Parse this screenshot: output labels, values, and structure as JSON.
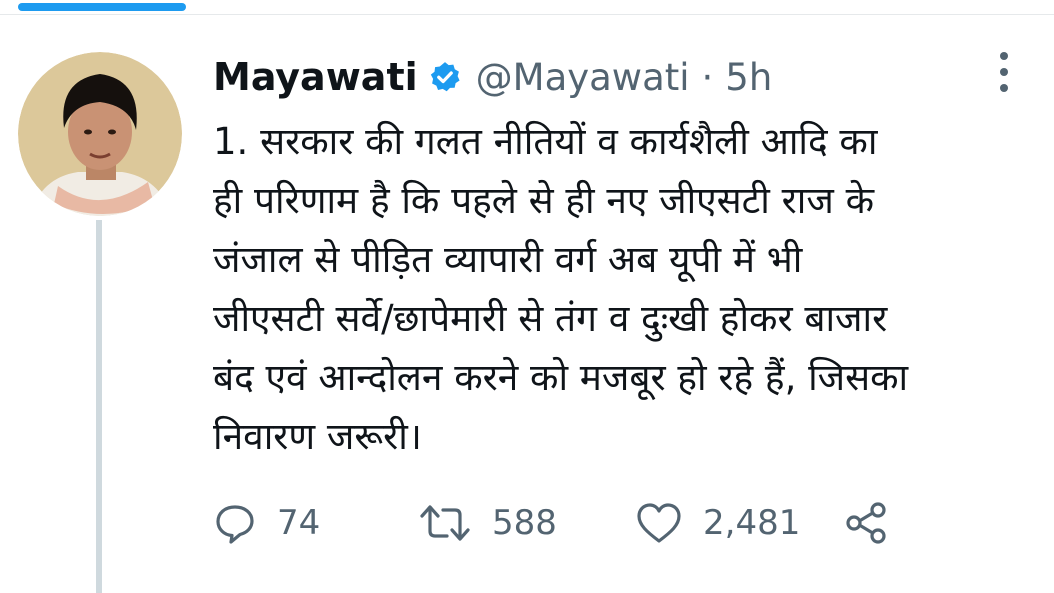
{
  "colors": {
    "accent": "#1d9bf0",
    "verified_badge": "#1d9bf0",
    "text_primary": "#0f1419",
    "text_secondary": "#536471",
    "thread_line": "#cfd9de"
  },
  "tweet": {
    "display_name": "Mayawati",
    "verified": true,
    "handle": "@Mayawati",
    "separator": "·",
    "time": "5h",
    "text": "1. सरकार की गलत नीतियों व कार्यशैली आदि का\nही परिणाम है कि पहले से ही नए जीएसटी राज के\nजंजाल से पीड़ित व्यापारी वर्ग अब यूपी में भी\nजीएसटी सर्वे/छापेमारी से तंग व दुःखी होकर बाजार\nबंद एवं आन्दोलन करने को मजबूर हो रहे हैं, जिसका\nनिवारण जरूरी।",
    "stats": {
      "replies": "74",
      "retweets": "588",
      "likes": "2,481"
    }
  },
  "icons": {
    "verified": "verified-badge-icon",
    "more": "more-vertical-icon",
    "reply": "speech-bubble-icon",
    "retweet": "retweet-arrows-icon",
    "like": "heart-icon",
    "share": "share-nodes-icon"
  }
}
